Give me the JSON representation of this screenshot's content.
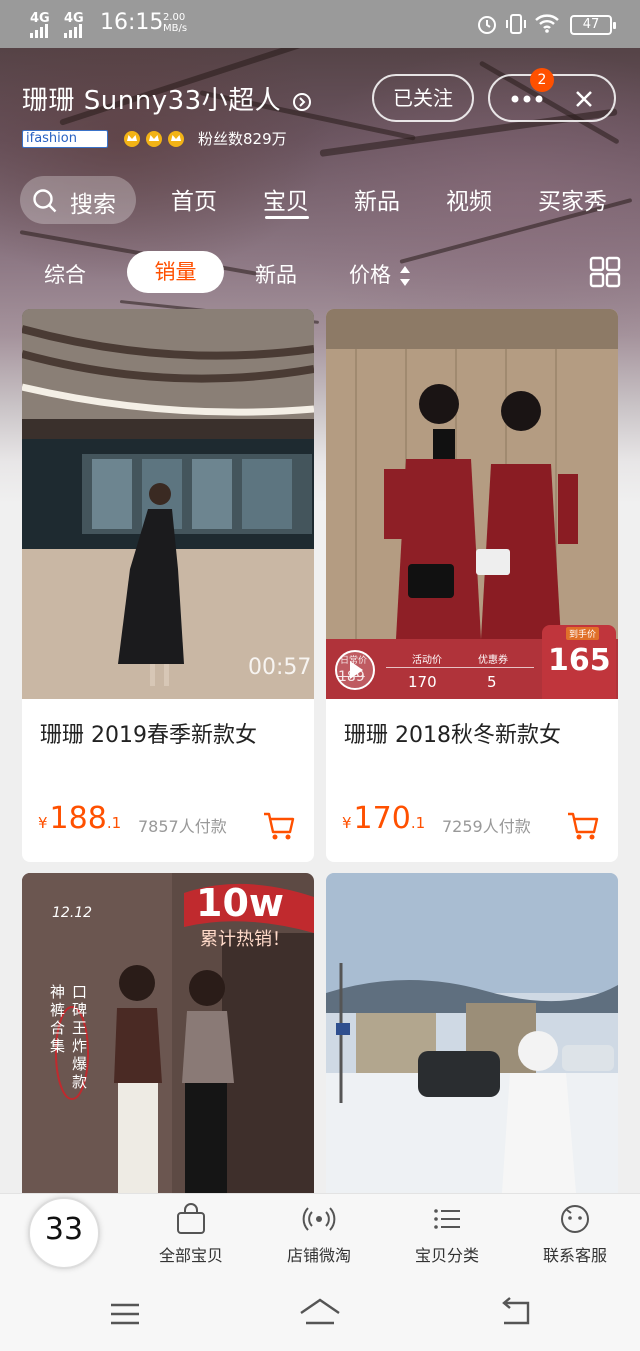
{
  "status_bar": {
    "network1": "4G",
    "network2": "4G",
    "time": "16:15",
    "speed_value": "2.00",
    "speed_unit": "MB/s",
    "battery": "47"
  },
  "shop": {
    "name": "珊珊 Sunny33小超人",
    "follow_label": "已关注",
    "notification_count": "2",
    "ifashion_label": "ifashion",
    "fans_label": "粉丝数829万"
  },
  "nav": {
    "search_label": "搜索",
    "tabs": [
      "首页",
      "宝贝",
      "新品",
      "视频",
      "买家秀"
    ],
    "active_tab": "宝贝"
  },
  "sort": {
    "options": [
      "综合",
      "销量",
      "新品",
      "价格"
    ],
    "active": "销量"
  },
  "products": [
    {
      "title": "珊珊 2019春季新款女",
      "currency": "¥",
      "price_int": "188",
      "price_dec": ".1",
      "sold": "7857人付款",
      "video_duration": "00:57"
    },
    {
      "title": "珊珊 2018秋冬新款女",
      "currency": "¥",
      "price_int": "170",
      "price_dec": ".1",
      "sold": "7259人付款",
      "promo": {
        "orig_label": "日常价",
        "orig_price": "189",
        "activity_label": "活动价",
        "activity_price": "170",
        "coupon_label": "优惠券",
        "coupon_value": "5",
        "final_label": "到手价",
        "final_price": "165"
      }
    },
    {
      "date": "12.12",
      "banner_big": "10w",
      "banner_sub": "累计热销！",
      "vertical_1": "神裤合集",
      "vertical_2": "口碑王炸爆款"
    },
    {}
  ],
  "bottom_bar": {
    "logo_text": "33",
    "items": [
      "全部宝贝",
      "店铺微淘",
      "宝贝分类",
      "联系客服"
    ]
  },
  "colors": {
    "accent": "#ff5000",
    "promo_red": "#b0333a"
  }
}
